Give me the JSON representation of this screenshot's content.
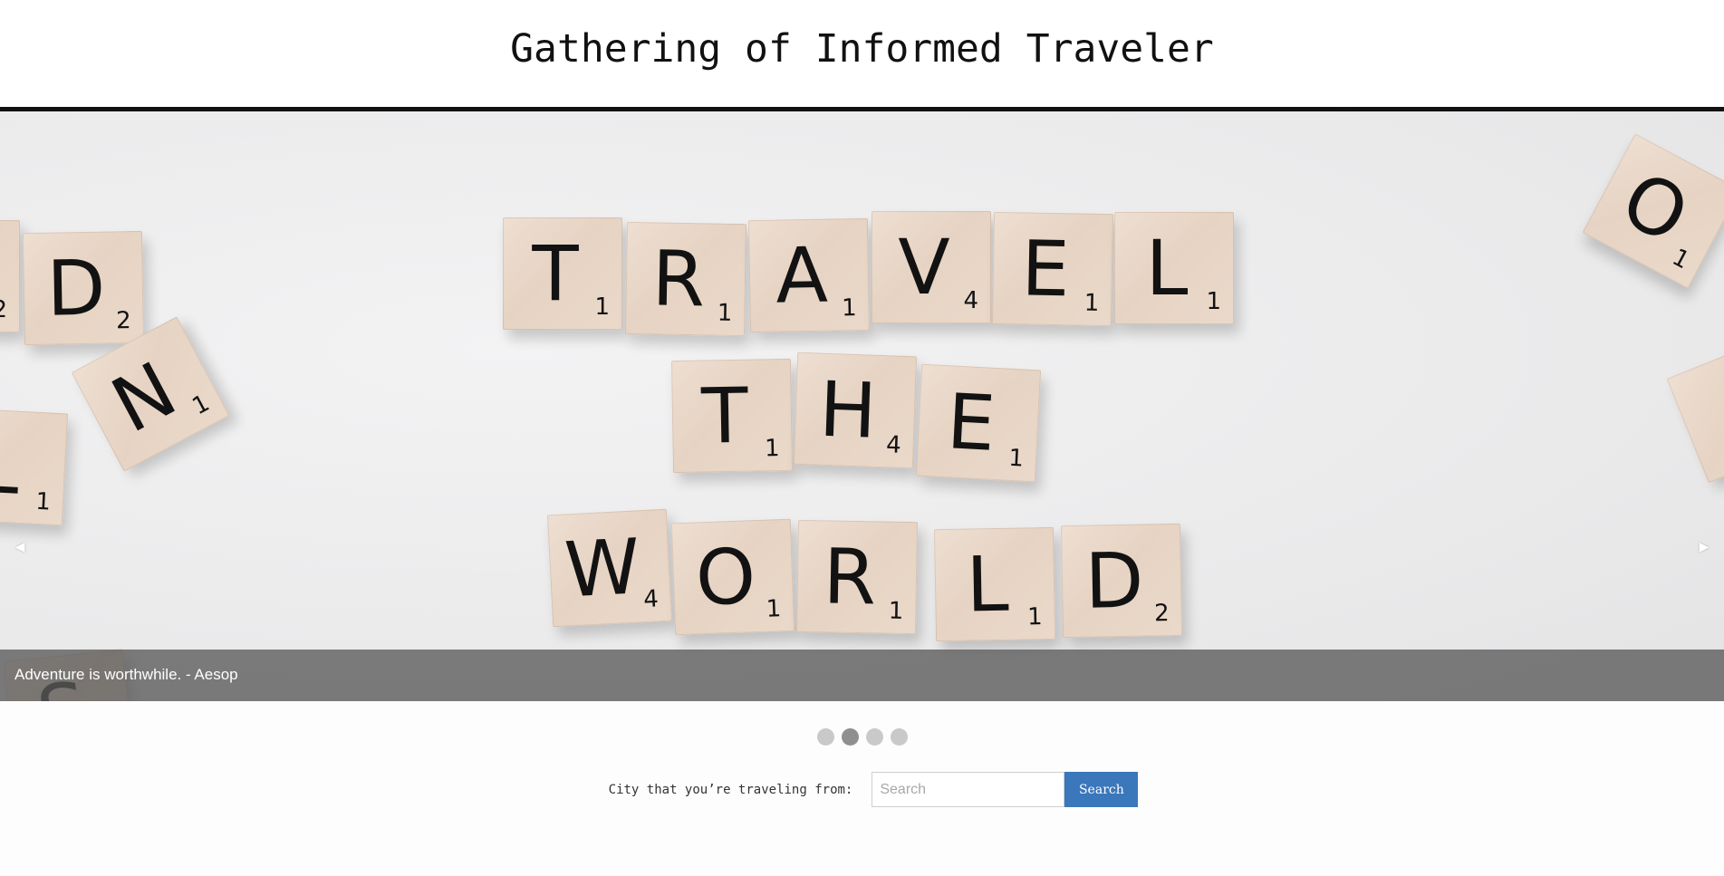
{
  "header": {
    "title": "Gathering of Informed Traveler"
  },
  "slider": {
    "tiles": [
      {
        "letter": "T",
        "points": "1"
      },
      {
        "letter": "R",
        "points": "1"
      },
      {
        "letter": "A",
        "points": "1"
      },
      {
        "letter": "V",
        "points": "4"
      },
      {
        "letter": "E",
        "points": "1"
      },
      {
        "letter": "L",
        "points": "1"
      },
      {
        "letter": "T",
        "points": "1"
      },
      {
        "letter": "H",
        "points": "4"
      },
      {
        "letter": "E",
        "points": "1"
      },
      {
        "letter": "W",
        "points": "4"
      },
      {
        "letter": "O",
        "points": "1"
      },
      {
        "letter": "R",
        "points": "1"
      },
      {
        "letter": "L",
        "points": "1"
      },
      {
        "letter": "D",
        "points": "2"
      },
      {
        "letter": "D",
        "points": "2"
      },
      {
        "letter": "N",
        "points": "1"
      },
      {
        "letter": "O",
        "points": "1"
      }
    ],
    "caption": "Adventure is worthwhile. - Aesop",
    "prev_icon": "caret-left-icon",
    "next_icon": "caret-right-icon",
    "dot_count": 4,
    "active_dot": 2
  },
  "search": {
    "label": "City that you’re traveling from:",
    "placeholder": "Search",
    "value": "",
    "button_label": "Search",
    "button_color": "#3b77bb"
  }
}
